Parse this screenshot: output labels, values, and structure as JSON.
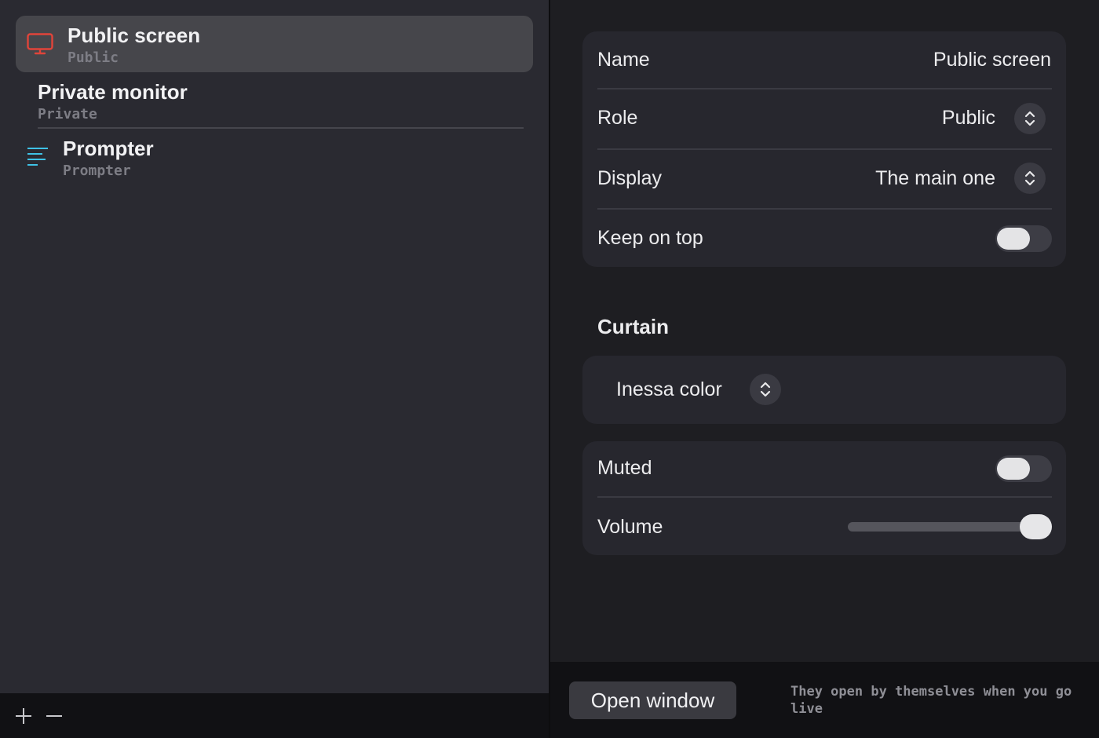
{
  "colors": {
    "accent_red": "#e0443a",
    "accent_cyan": "#3fc2e6",
    "selected_row": "#46464b"
  },
  "sidebar": {
    "items": [
      {
        "title": "Public screen",
        "subtitle": "Public",
        "icon": "monitor-icon",
        "selected": true
      },
      {
        "title": "Private monitor",
        "subtitle": "Private",
        "icon": "",
        "selected": false
      },
      {
        "title": "Prompter",
        "subtitle": "Prompter",
        "icon": "lines-icon",
        "selected": false
      }
    ],
    "toolbar": {
      "add": "+",
      "remove": "−"
    }
  },
  "detail": {
    "general": {
      "name": {
        "label": "Name",
        "value": "Public screen"
      },
      "role": {
        "label": "Role",
        "value": "Public"
      },
      "display": {
        "label": "Display",
        "value": "The main one"
      },
      "keep_on_top": {
        "label": "Keep on top",
        "on": false
      }
    },
    "curtain": {
      "title": "Curtain",
      "value": "Inessa color"
    },
    "audio": {
      "muted": {
        "label": "Muted",
        "on": false
      },
      "volume": {
        "label": "Volume",
        "level": 1.0
      }
    }
  },
  "footer": {
    "open_button": "Open window",
    "note": "They open by themselves when you go live"
  }
}
